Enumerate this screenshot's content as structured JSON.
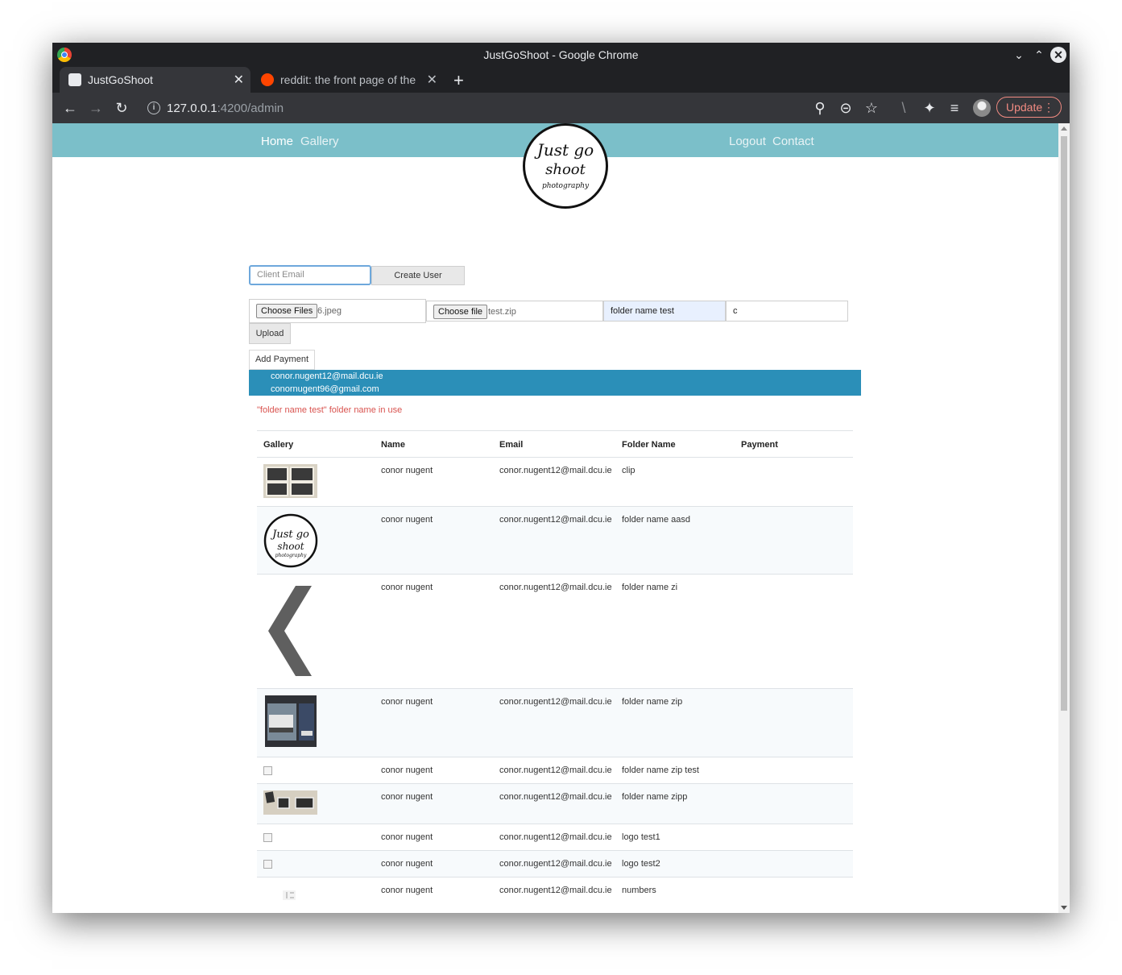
{
  "window": {
    "title": "JustGoShoot - Google Chrome"
  },
  "tabs": [
    {
      "label": "JustGoShoot",
      "active": true
    },
    {
      "label": "reddit: the front page of the internet",
      "active": false
    }
  ],
  "address": {
    "host": "127.0.0.1",
    "path": ":4200/admin"
  },
  "toolbar": {
    "update_label": "Update"
  },
  "nav": {
    "home": "Home",
    "gallery": "Gallery",
    "logout": "Logout",
    "contact": "Contact"
  },
  "logo": {
    "line1": "Just go",
    "line2": "shoot",
    "line3": "photography"
  },
  "create_user": {
    "email_placeholder": "Client Email",
    "button": "Create User"
  },
  "upload": {
    "files_button": "Choose Files",
    "files_value": "6.jpeg",
    "file_button": "Choose file",
    "file_value": "test.zip",
    "folder_value": "folder name test",
    "extra_value": "c",
    "upload_button": "Upload"
  },
  "payment": {
    "button": "Add Payment",
    "options": [
      "conor.nugent12@mail.dcu.ie",
      "conornugent96@gmail.com"
    ]
  },
  "error_message": "\"folder name test\" folder name in use",
  "table": {
    "headers": [
      "Gallery",
      "Name",
      "Email",
      "Folder Name",
      "Payment"
    ],
    "rows": [
      {
        "thumb": "frame-collage",
        "name": "conor nugent",
        "email": "conor.nugent12@mail.dcu.ie",
        "folder": "clip",
        "payment": ""
      },
      {
        "thumb": "logo",
        "name": "conor nugent",
        "email": "conor.nugent12@mail.dcu.ie",
        "folder": "folder name aasd",
        "payment": ""
      },
      {
        "thumb": "chevron",
        "name": "conor nugent",
        "email": "conor.nugent12@mail.dcu.ie",
        "folder": "folder name zi",
        "payment": ""
      },
      {
        "thumb": "bus-photo",
        "name": "conor nugent",
        "email": "conor.nugent12@mail.dcu.ie",
        "folder": "folder name zip",
        "payment": ""
      },
      {
        "thumb": "broken",
        "name": "conor nugent",
        "email": "conor.nugent12@mail.dcu.ie",
        "folder": "folder name zip test",
        "payment": ""
      },
      {
        "thumb": "frames-wide",
        "name": "conor nugent",
        "email": "conor.nugent12@mail.dcu.ie",
        "folder": "folder name zipp",
        "payment": ""
      },
      {
        "thumb": "broken",
        "name": "conor nugent",
        "email": "conor.nugent12@mail.dcu.ie",
        "folder": "logo test1",
        "payment": ""
      },
      {
        "thumb": "broken",
        "name": "conor nugent",
        "email": "conor.nugent12@mail.dcu.ie",
        "folder": "logo test2",
        "payment": ""
      },
      {
        "thumb": "numbers",
        "name": "conor nugent",
        "email": "conor.nugent12@mail.dcu.ie",
        "folder": "numbers",
        "payment": ""
      }
    ]
  },
  "colors": {
    "navbar": "#7bbfc9",
    "selection": "#2b8fb8",
    "error": "#d9534f",
    "update_accent": "#f28b82"
  }
}
